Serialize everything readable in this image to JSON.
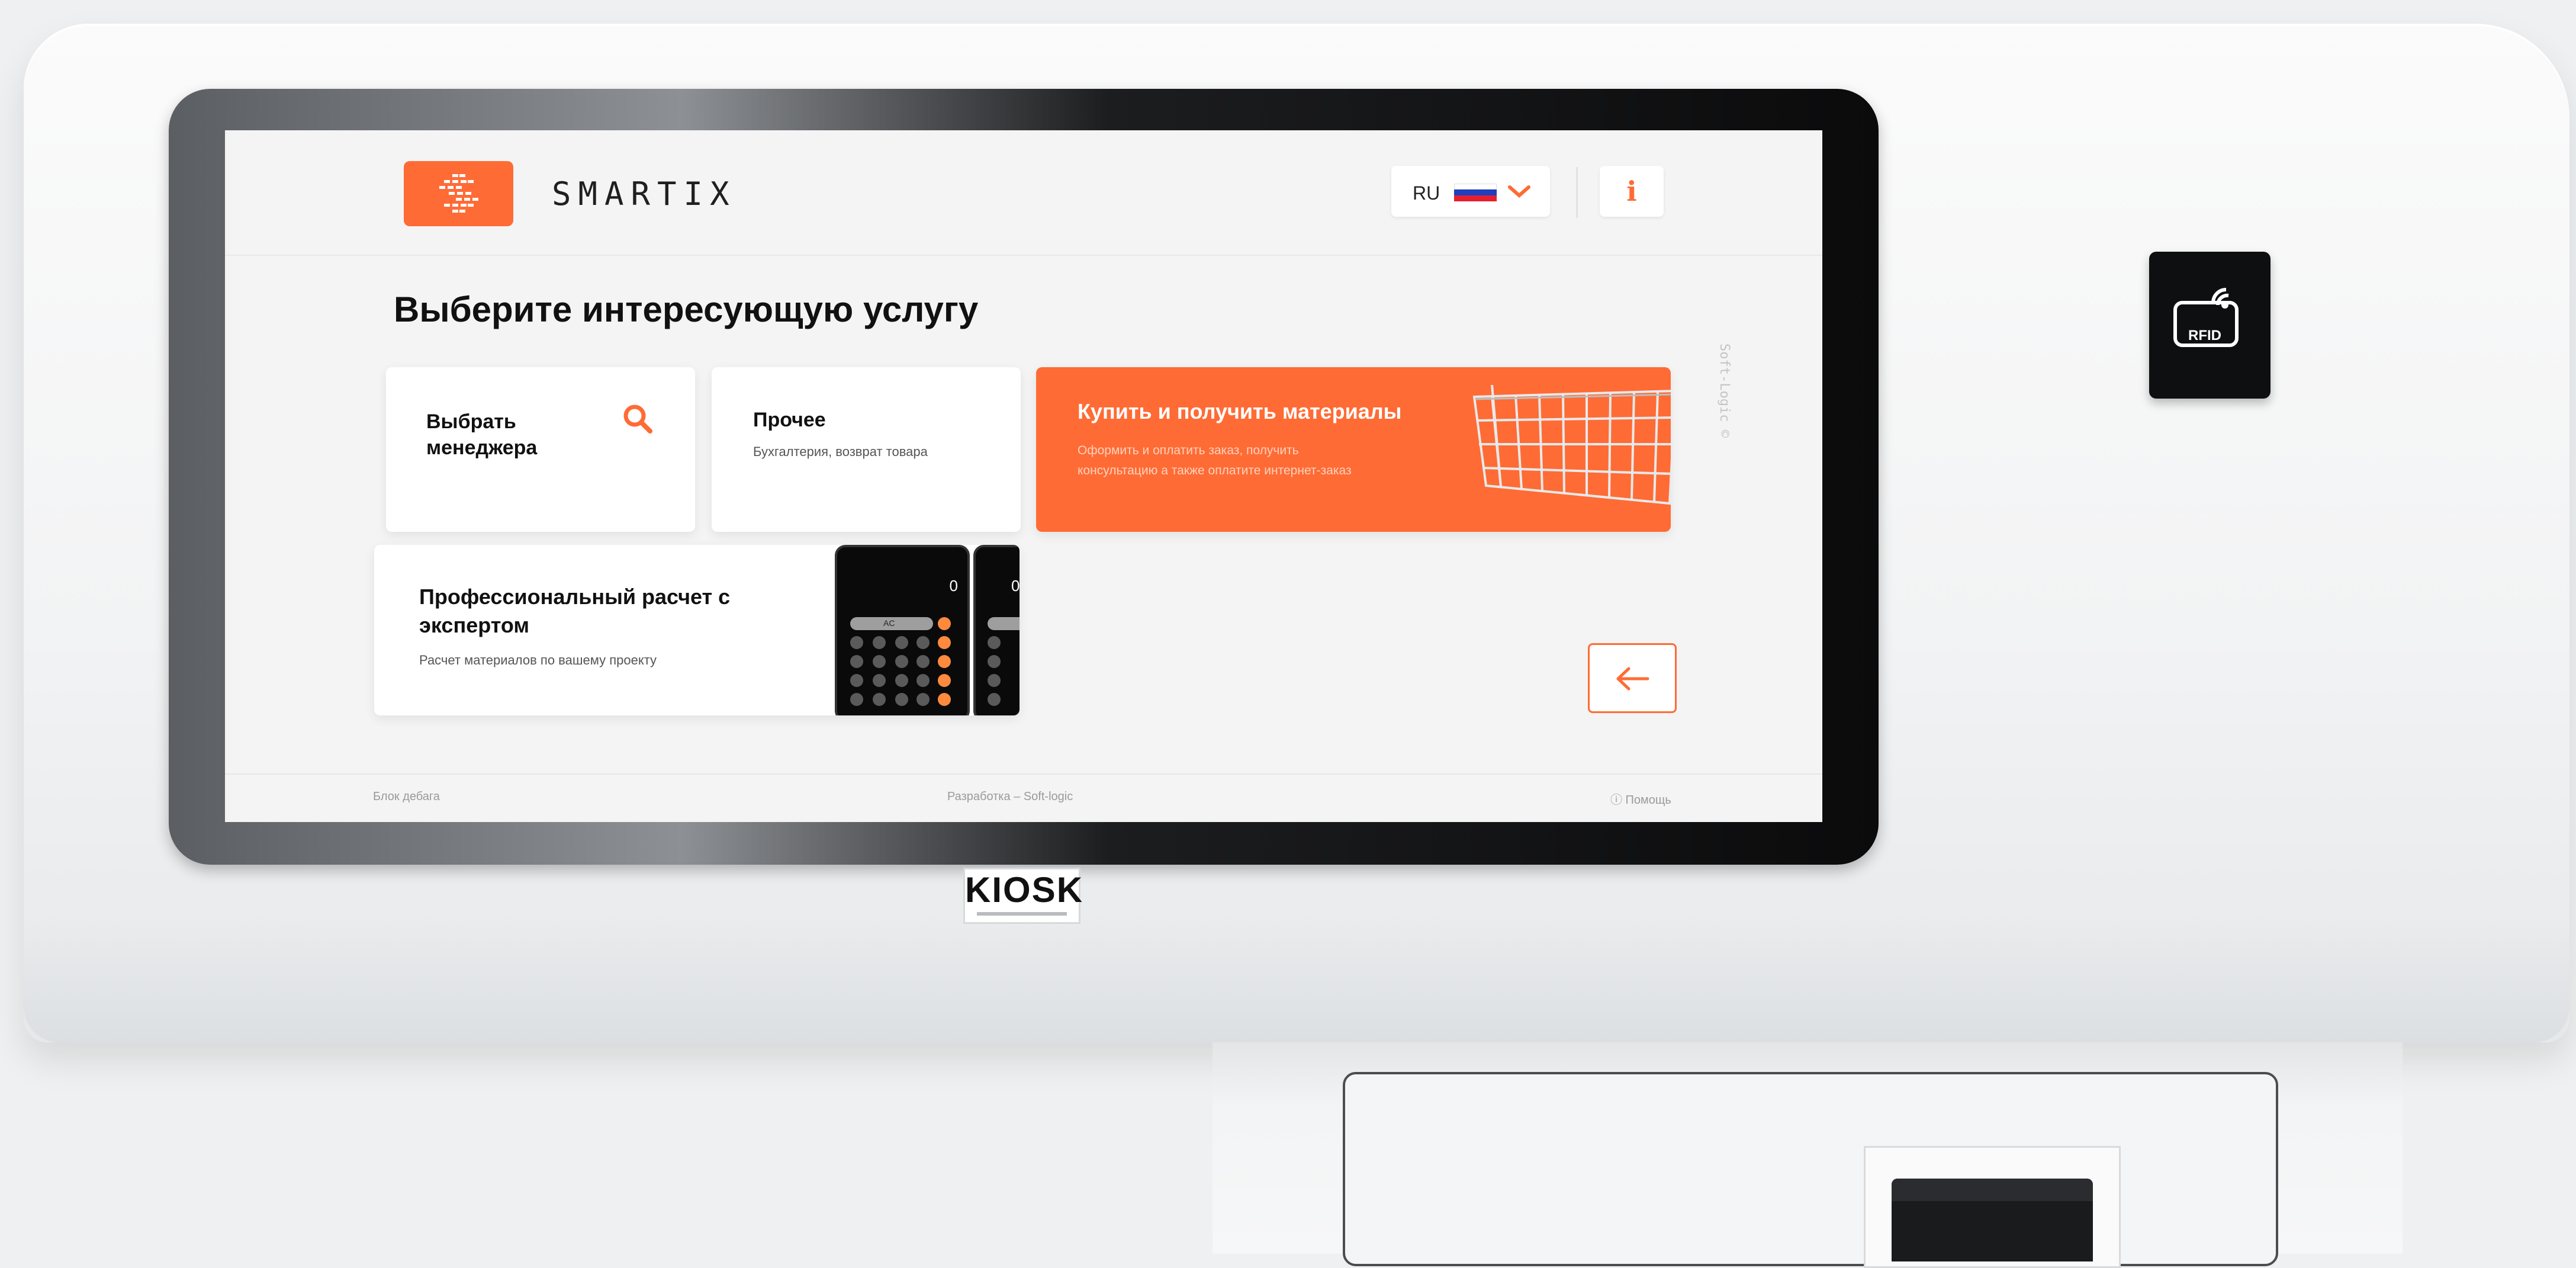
{
  "app": {
    "brand": "SMARTIX"
  },
  "header": {
    "language_code": "RU",
    "info_label": "i"
  },
  "main": {
    "title": "Выберите интересующую услугу",
    "side_text": "Soft-Logic ©",
    "tiles": [
      {
        "title": "Выбрать менеджера",
        "subtitle": "",
        "icon": "search-icon"
      },
      {
        "title": "Прочее",
        "subtitle": "Бухгалтерия, возврат товара"
      },
      {
        "title": "Купить и получить материалы",
        "subtitle": "Оформить и оплатить заказ, получить консультацию а также оплатите интернет-заказ",
        "icon": "shopping-cart-image",
        "accent": "#ff6b35"
      },
      {
        "title": "Профессиональный расчет с экспертом",
        "subtitle": "Расчет материалов по вашему проекту",
        "icon": "calculator-phone-image"
      }
    ],
    "back_icon": "arrow-left-icon"
  },
  "phone_display": "0",
  "phone_key_label": "AC",
  "footer": {
    "left": "Блок дебага",
    "center": "Разработка – Soft-logic",
    "right": "ⓘ Помощь"
  },
  "hardware": {
    "kiosk_label": "KIOSK",
    "rfid_label": "RFID"
  },
  "colors": {
    "accent": "#ff6b35",
    "screen_bg": "#f4f4f4",
    "tile_bg": "#ffffff",
    "flag": [
      "#ffffff",
      "#1f3fbf",
      "#e5202e"
    ]
  }
}
